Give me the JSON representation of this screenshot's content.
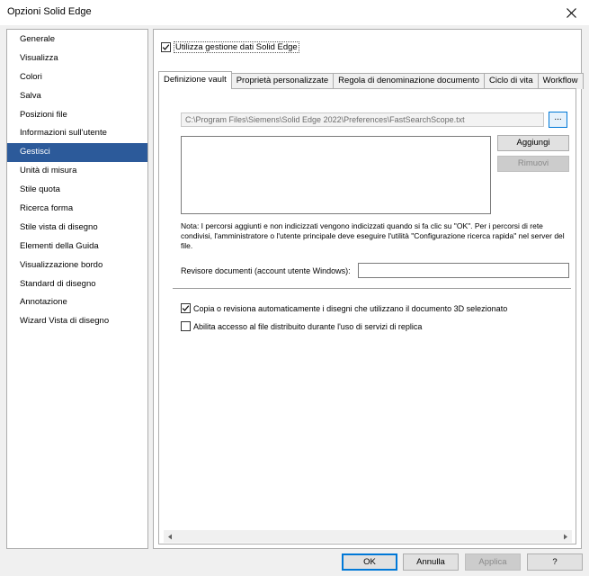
{
  "window": {
    "title": "Opzioni Solid Edge"
  },
  "sidebar": {
    "items": [
      {
        "label": "Generale"
      },
      {
        "label": "Visualizza"
      },
      {
        "label": "Colori"
      },
      {
        "label": "Salva"
      },
      {
        "label": "Posizioni file"
      },
      {
        "label": "Informazioni sull'utente"
      },
      {
        "label": "Gestisci",
        "selected": true
      },
      {
        "label": "Unità di misura"
      },
      {
        "label": "Stile quota"
      },
      {
        "label": "Ricerca forma"
      },
      {
        "label": "Stile vista di disegno"
      },
      {
        "label": "Elementi della Guida"
      },
      {
        "label": "Visualizzazione bordo"
      },
      {
        "label": "Standard di disegno"
      },
      {
        "label": "Annotazione"
      },
      {
        "label": "Wizard Vista di disegno"
      }
    ]
  },
  "main": {
    "use_data_mgmt": {
      "label": "Utilizza gestione dati Solid Edge",
      "checked": true
    },
    "tabs": [
      {
        "label": "Definizione vault",
        "active": true
      },
      {
        "label": "Proprietà personalizzate"
      },
      {
        "label": "Regola di denominazione documento"
      },
      {
        "label": "Ciclo di vita"
      },
      {
        "label": "Workflow"
      }
    ],
    "vault": {
      "scope_path": "C:\\Program Files\\Siemens\\Solid Edge 2022\\Preferences\\FastSearchScope.txt",
      "browse_label": "...",
      "add_label": "Aggiungi",
      "remove_label": "Rimuovi",
      "note": "Nota: I percorsi aggiunti e non indicizzati vengono indicizzati quando si fa clic su \"OK\". Per i percorsi di rete condivisi, l'amministratore o l'utente principale deve eseguire l'utilità \"Configurazione ricerca rapida\" nel server del file.",
      "reviewer_label": "Revisore documenti (account utente Windows):",
      "reviewer_value": "",
      "copy_revise_label": "Copia o revisiona automaticamente i disegni che utilizzano il documento 3D selezionato",
      "copy_revise_checked": true,
      "replication_label": "Abilita accesso al file distribuito durante l'uso di servizi di replica",
      "replication_checked": false
    }
  },
  "footer": {
    "ok_label": "OK",
    "cancel_label": "Annulla",
    "apply_label": "Applica",
    "help_label": "?"
  },
  "colors": {
    "selection": "#2c5a9a",
    "accent": "#0078d7"
  }
}
